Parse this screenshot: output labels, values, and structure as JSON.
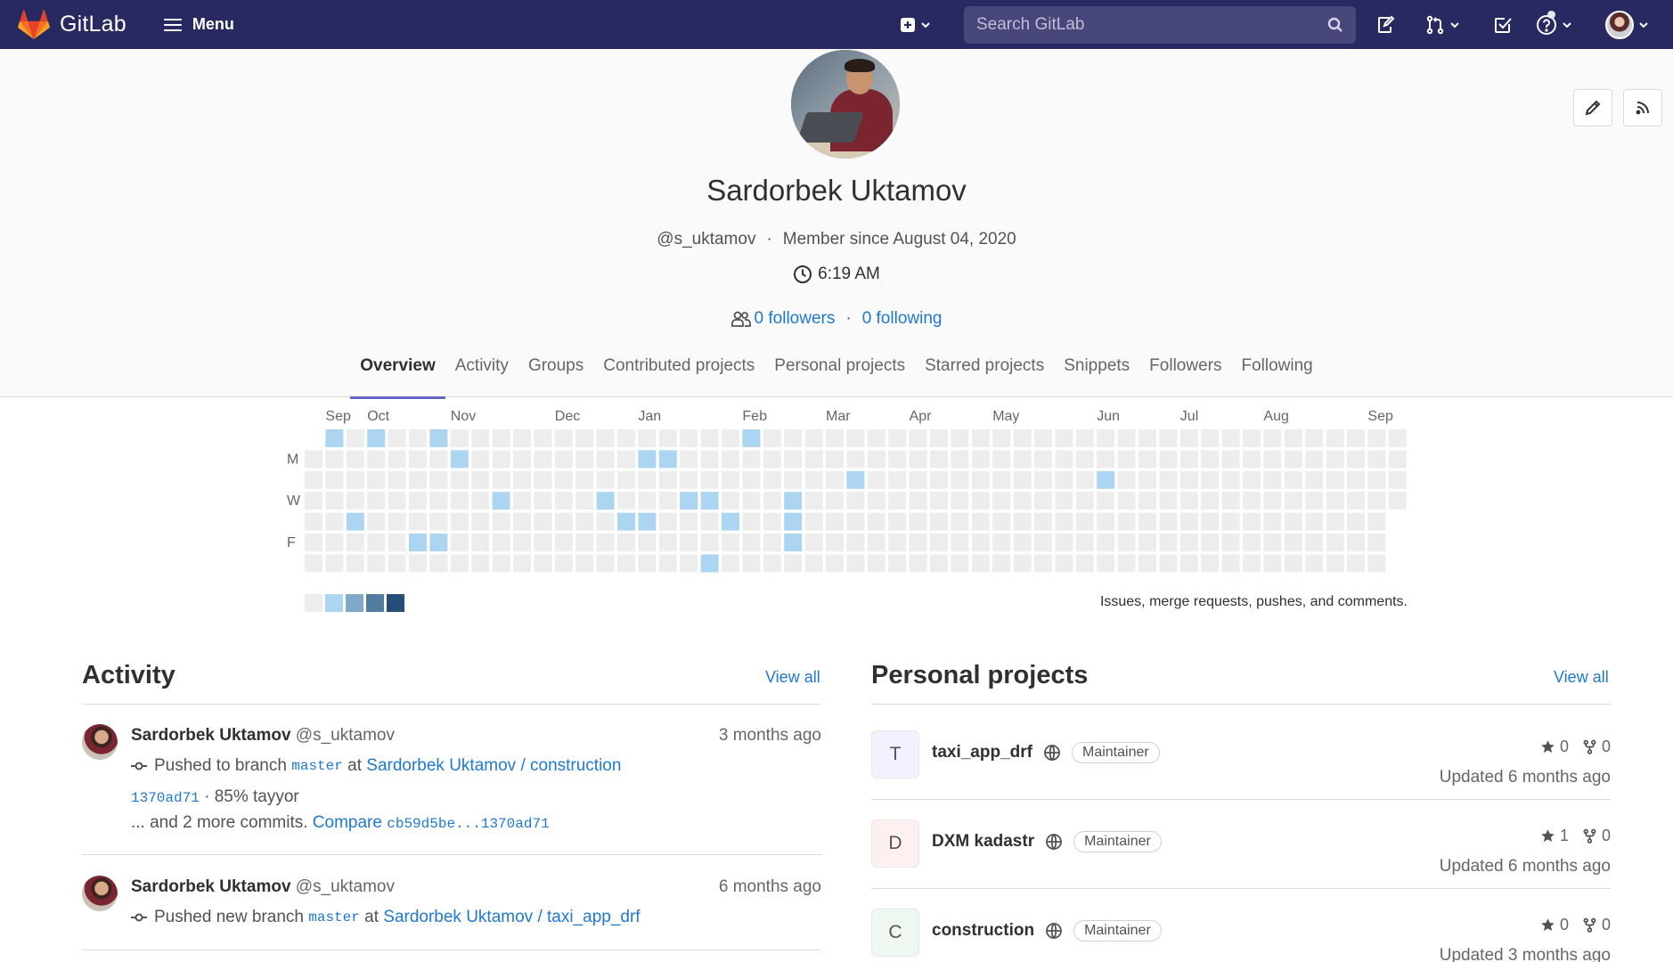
{
  "nav": {
    "brand": "GitLab",
    "menu_label": "Menu",
    "search_placeholder": "Search GitLab"
  },
  "profile": {
    "name": "Sardorbek Uktamov",
    "username": "@s_uktamov",
    "member_since": "Member since August 04, 2020",
    "local_time": "6:19 AM",
    "followers": "0 followers",
    "following": "0 following"
  },
  "tabs": [
    "Overview",
    "Activity",
    "Groups",
    "Contributed projects",
    "Personal projects",
    "Starred projects",
    "Snippets",
    "Followers",
    "Following"
  ],
  "calendar": {
    "months": [
      "Sep",
      "Oct",
      "Nov",
      "Dec",
      "Jan",
      "Feb",
      "Mar",
      "Apr",
      "May",
      "Jun",
      "Jul",
      "Aug",
      "Sep"
    ],
    "day_labels": [
      "M",
      "W",
      "F"
    ],
    "note": "Issues, merge requests, pushes, and comments.",
    "colors": {
      "empty": "#ededed",
      "l1": "#acd5f2",
      "l2": "#7fa8c9",
      "l3": "#527ba0",
      "l4": "#254e77"
    },
    "total_weeks": 53,
    "active_cells": [
      [
        1,
        0
      ],
      [
        3,
        0
      ],
      [
        6,
        0
      ],
      [
        21,
        0
      ],
      [
        7,
        1
      ],
      [
        16,
        1
      ],
      [
        17,
        1
      ],
      [
        26,
        2
      ],
      [
        38,
        2
      ],
      [
        9,
        3
      ],
      [
        14,
        3
      ],
      [
        18,
        3
      ],
      [
        19,
        3
      ],
      [
        23,
        3
      ],
      [
        2,
        4
      ],
      [
        15,
        4
      ],
      [
        16,
        4
      ],
      [
        20,
        4
      ],
      [
        23,
        4
      ],
      [
        5,
        5
      ],
      [
        6,
        5
      ],
      [
        23,
        5
      ],
      [
        19,
        6
      ]
    ]
  },
  "activity": {
    "title": "Activity",
    "view_all": "View all",
    "events": [
      {
        "author": "Sardorbek Uktamov",
        "handle": "@s_uktamov",
        "time": "3 months ago",
        "action": "Pushed to branch",
        "branch": "master",
        "at": "at",
        "project": "Sardorbek Uktamov / construction",
        "commit_sha": "1370ad71",
        "commit_msg": "· 85% tayyor",
        "more": "... and 2 more commits.",
        "compare_label": "Compare",
        "compare_range": "cb59d5be...1370ad71"
      },
      {
        "author": "Sardorbek Uktamov",
        "handle": "@s_uktamov",
        "time": "6 months ago",
        "action": "Pushed new branch",
        "branch": "master",
        "at": "at",
        "project": "Sardorbek Uktamov / taxi_app_drf"
      }
    ]
  },
  "personal_projects": {
    "title": "Personal projects",
    "view_all": "View all",
    "items": [
      {
        "letter": "T",
        "name": "taxi_app_drf",
        "role": "Maintainer",
        "stars": "0",
        "forks": "0",
        "updated": "Updated 6 months ago",
        "color": "#f3f1ff"
      },
      {
        "letter": "D",
        "name": "DXM kadastr",
        "role": "Maintainer",
        "stars": "1",
        "forks": "0",
        "updated": "Updated 6 months ago",
        "color": "#fdf0ee"
      },
      {
        "letter": "C",
        "name": "construction",
        "role": "Maintainer",
        "stars": "0",
        "forks": "0",
        "updated": "Updated 3 months ago",
        "color": "#eef8f1"
      }
    ]
  }
}
